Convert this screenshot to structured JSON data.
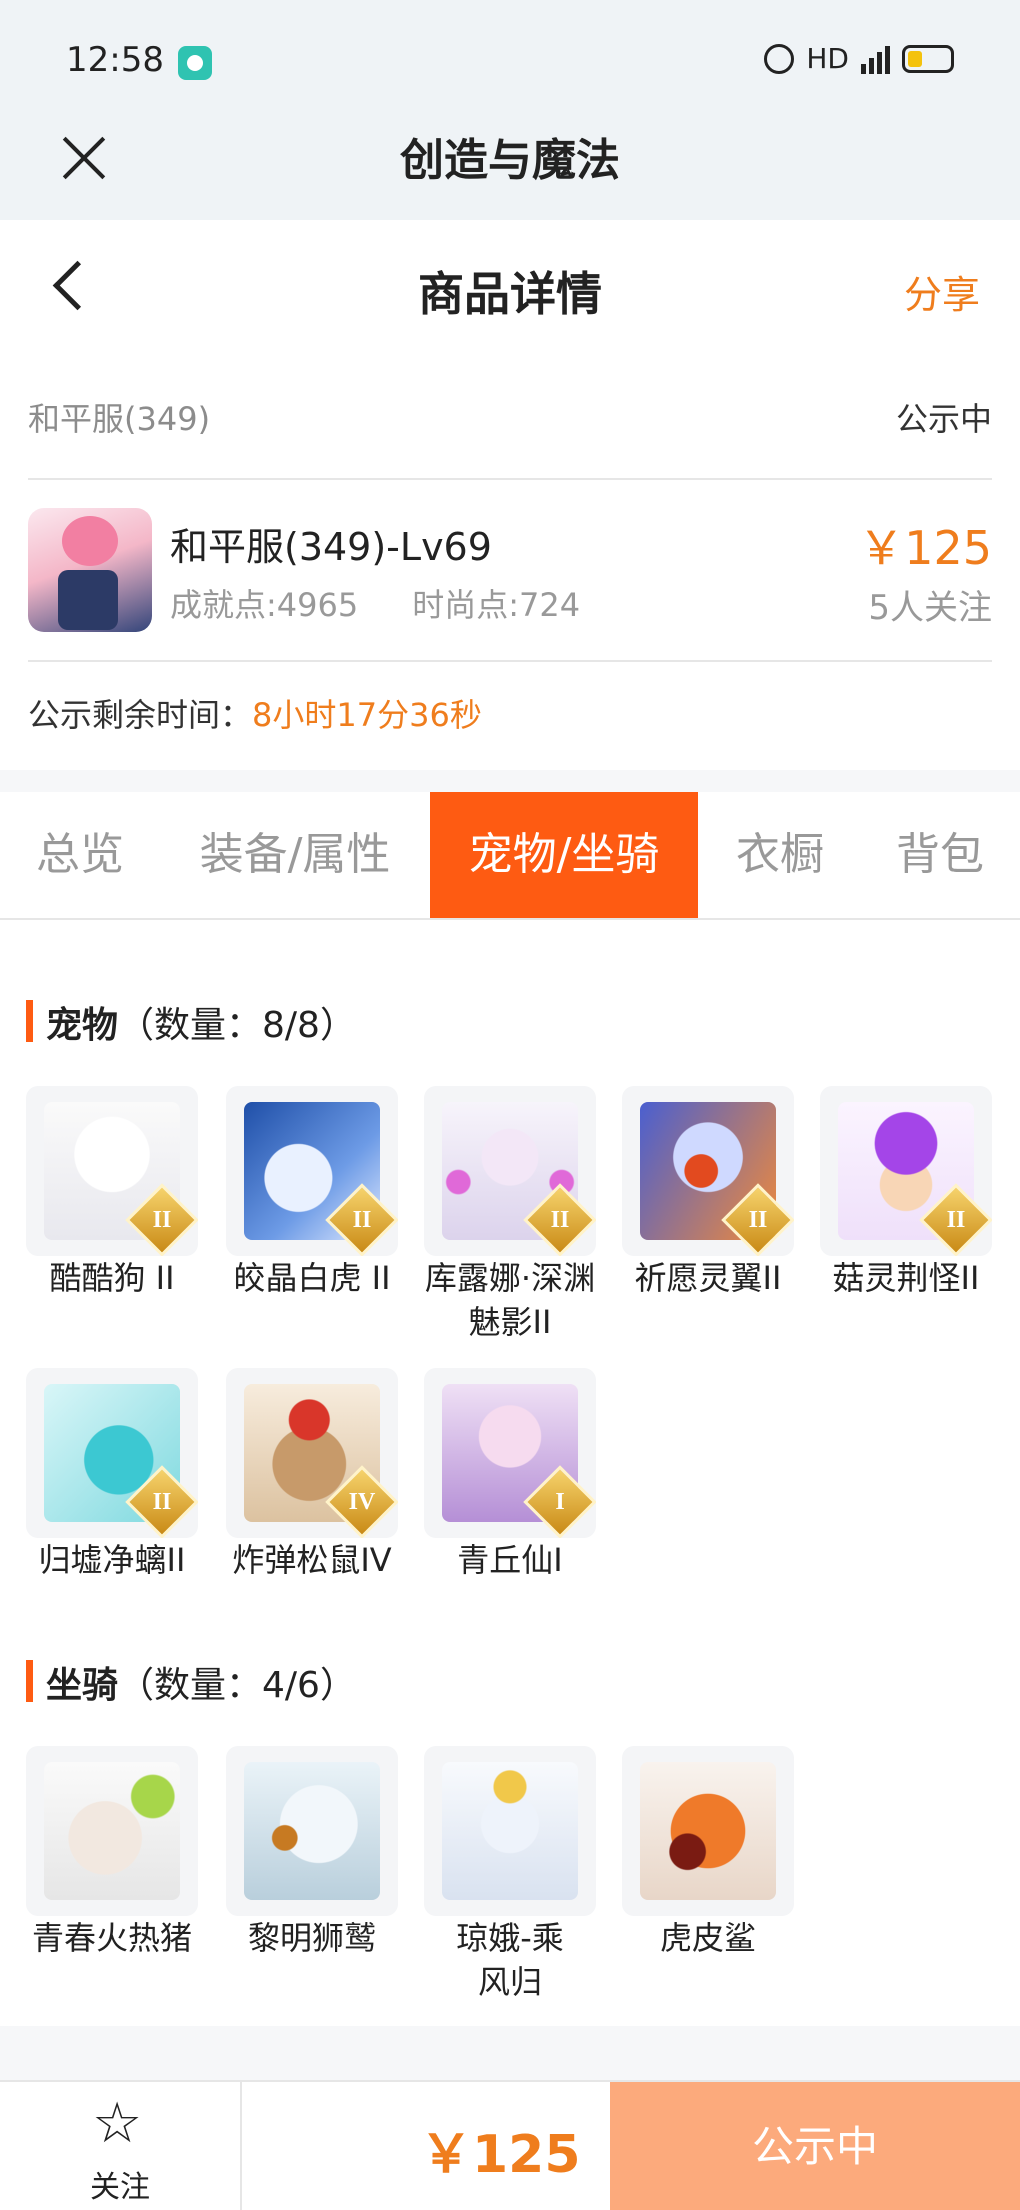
{
  "status_bar": {
    "time": "12:58",
    "network": "HD",
    "network_type": "4G"
  },
  "app": {
    "title": "创造与魔法"
  },
  "nav": {
    "title": "商品详情",
    "share_label": "分享"
  },
  "server": {
    "name": "和平服(349)",
    "status": "公示中"
  },
  "product": {
    "title": "和平服(349)-Lv69",
    "achievement": "成就点:4965",
    "fashion": "时尚点:724",
    "price": "￥125",
    "followers": "5人关注"
  },
  "remaining": {
    "label": "公示剩余时间：",
    "value": "8小时17分36秒"
  },
  "tabs": [
    {
      "label": "总览",
      "active": false
    },
    {
      "label": "装备/属性",
      "active": false
    },
    {
      "label": "宠物/坐骑",
      "active": true
    },
    {
      "label": "衣橱",
      "active": false
    },
    {
      "label": "背包",
      "active": false
    }
  ],
  "pets": {
    "title": "宠物",
    "count": "（数量：8/8）",
    "items": [
      {
        "name": "酷酷狗 II",
        "badge": "II",
        "icon": "polar-bear-goggles-icon"
      },
      {
        "name": "皎晶白虎 II",
        "badge": "II",
        "icon": "white-tiger-icon"
      },
      {
        "name": "库露娜·深渊魅影II",
        "badge": "II",
        "icon": "fairy-girl-icon"
      },
      {
        "name": "祈愿灵翼II",
        "badge": "II",
        "icon": "phoenix-bird-icon"
      },
      {
        "name": "菇灵荆怪II",
        "badge": "II",
        "icon": "mushroom-sprite-icon"
      },
      {
        "name": "归墟净螭II",
        "badge": "II",
        "icon": "cyan-dragon-icon"
      },
      {
        "name": "炸弹松鼠IV",
        "badge": "IV",
        "icon": "bomb-squirrel-icon"
      },
      {
        "name": "青丘仙I",
        "badge": "I",
        "icon": "fox-spirit-icon"
      }
    ]
  },
  "mounts": {
    "title": "坐骑",
    "count": "（数量：4/6）",
    "items": [
      {
        "name": "青春火热猪",
        "icon": "pig-mount-icon"
      },
      {
        "name": "黎明狮鹫",
        "icon": "griffin-icon"
      },
      {
        "name": "琼娥-乘风归",
        "icon": "moon-maiden-icon"
      },
      {
        "name": "虎皮鲨",
        "icon": "tiger-shark-icon"
      }
    ]
  },
  "bottom": {
    "follow_label": "关注",
    "price": "￥125",
    "status_button": "公示中"
  },
  "colors": {
    "accent": "#fe5b12",
    "price": "#ef7d1d",
    "status_button_bg": "#fcaa7c"
  }
}
